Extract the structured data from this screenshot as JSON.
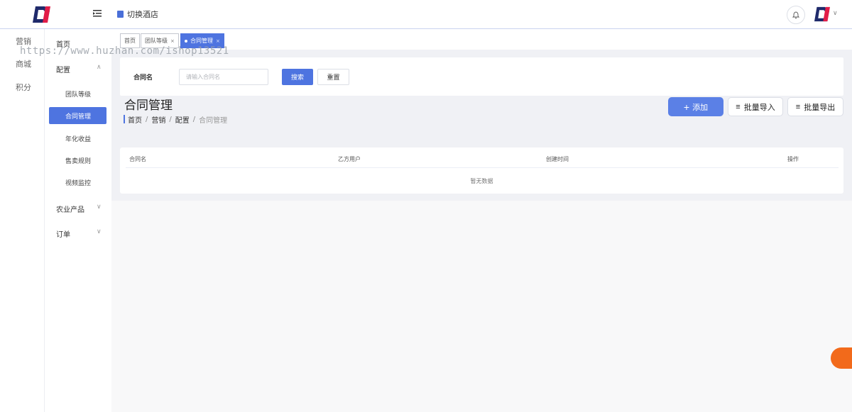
{
  "header": {
    "hotel_switch_label": "切换酒店"
  },
  "rail": {
    "items": [
      "营销",
      "商城",
      "积分"
    ]
  },
  "sidebar": {
    "home": "首页",
    "config": "配置",
    "config_children": [
      "团队等级",
      "合同管理",
      "年化收益",
      "售卖规则",
      "视频监控"
    ],
    "active_child": "合同管理",
    "agri_products": "农业产品",
    "orders": "订单"
  },
  "tabs": [
    {
      "label": "首页",
      "closable": false,
      "active": false
    },
    {
      "label": "团队等级",
      "closable": true,
      "active": false
    },
    {
      "label": "合同管理",
      "closable": true,
      "active": true
    }
  ],
  "search": {
    "label": "合同名",
    "placeholder": "请输入合同名",
    "search_button": "搜索",
    "reset_button": "重置"
  },
  "page": {
    "title": "合同管理",
    "breadcrumb": [
      "首页",
      "营销",
      "配置",
      "合同管理"
    ]
  },
  "actions": {
    "add": "添加",
    "import": "批量导入",
    "export": "批量导出"
  },
  "table": {
    "columns": [
      "合同名",
      "乙方用户",
      "创建时间",
      "操作"
    ],
    "empty_text": "暂无数据"
  },
  "watermark": "https://www.huzhan.com/ishop13521",
  "colors": {
    "primary": "#4e74e0",
    "badge": "#f26a1b"
  }
}
